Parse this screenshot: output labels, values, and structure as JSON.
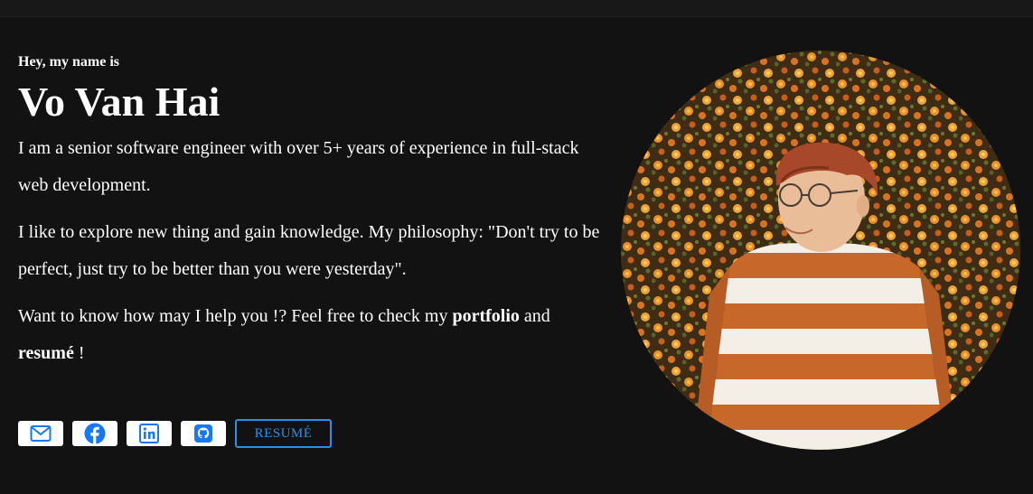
{
  "header": {
    "greeting": "Hey, my name is",
    "name": "Vo Van Hai"
  },
  "about": {
    "p1": "I am a senior software engineer with over 5+ years of experience in full-stack web development.",
    "p2": "I like to explore new thing and gain knowledge. My philosophy: \"Don't try to be perfect, just try to be better than you were yesterday\".",
    "p3_prefix": "Want to know how may I help you !? Feel free to check my ",
    "p3_portfolio": "portfolio",
    "p3_and": " and ",
    "p3_resume": "resumé",
    "p3_suffix": " !"
  },
  "socials": {
    "items": [
      {
        "icon": "mail-icon",
        "label": "Email"
      },
      {
        "icon": "facebook-icon",
        "label": "Facebook"
      },
      {
        "icon": "linkedin-icon",
        "label": "LinkedIn"
      },
      {
        "icon": "github-icon",
        "label": "GitHub"
      }
    ],
    "resume_label": "RESUMÉ"
  },
  "colors": {
    "background": "#121212",
    "text": "#ffffff",
    "accent": "#2c8fe8"
  }
}
